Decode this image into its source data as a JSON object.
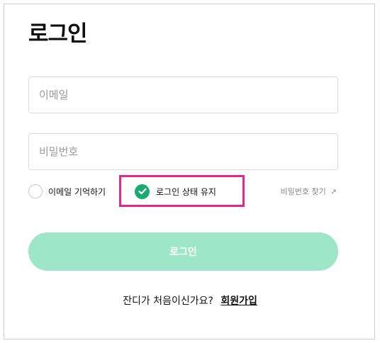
{
  "login": {
    "title": "로그인",
    "email_placeholder": "이메일",
    "password_placeholder": "비밀번호",
    "remember_email_label": "이메일 기억하기",
    "remember_email_checked": false,
    "keep_logged_in_label": "로그인 상태 유지",
    "keep_logged_in_checked": true,
    "find_password_label": "비밀번호 찾기",
    "find_password_icon": "arrow-up-right-icon",
    "submit_label": "로그인",
    "signup_prompt": "잔디가 처음이신가요?",
    "signup_link": "회원가입"
  },
  "colors": {
    "accent_green": "#1aa873",
    "button_disabled_green": "#9de6c8",
    "highlight_pink": "#e6268f"
  }
}
